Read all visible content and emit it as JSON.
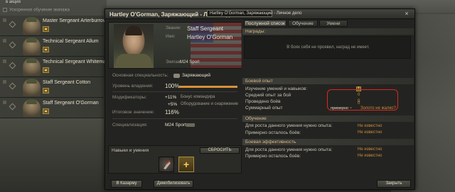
{
  "background": {
    "top_left_label": "в акция",
    "accelerated_training_label": "Ускоренное обучение экипажа"
  },
  "crew": [
    {
      "name": "Master Sergeant Arterburrow"
    },
    {
      "name": "Technical Sergeant Allum"
    },
    {
      "name": "Technical Sergeant Whiteman"
    },
    {
      "name": "Staff Sergeant Cotton"
    },
    {
      "name": "Staff Sergeant O'Gorman"
    }
  ],
  "dialog": {
    "title": "Hartley O'Gorman, Заряжающий - Личное дело",
    "close_glyph": "×",
    "profile": {
      "rank_label": "Звание:",
      "rank_value": "Staff Sergeant",
      "name_label": "Имя:",
      "name_value": "Hartley O'Gorman",
      "vehicle_label": "Экипаж:",
      "vehicle_value": "M24 Sport"
    },
    "spec": {
      "main_spec_label": "Основная специальность:",
      "main_spec_value": "Заряжающий",
      "mastery_label": "Уровень владения:",
      "mastery_value": "100%",
      "mastery_fill": 1.0,
      "modifiers_label": "Модификаторы:",
      "mod1_value": "+11%",
      "mod1_note": "Бонус командира",
      "mod2_value": "+5%",
      "mod2_note": "Оборудование и снаряжение",
      "total_label": "Итоговое значение:",
      "total_value": "116%",
      "specialization_label": "Специализация:",
      "specialization_value": "M24 Sport"
    },
    "skills": {
      "header": "Навыки и умения",
      "reset_label": "СБРОСИТЬ",
      "add_glyph": "+"
    },
    "tabs": [
      {
        "label": "Послужной список"
      },
      {
        "label": "Обучение"
      },
      {
        "label": "Умени"
      }
    ],
    "tooltip": "Hartley O'Gorman, Заряжающий - Личное дело",
    "awards": {
      "header": "Награды:",
      "empty_message": "В боях себя не проявил, наград не имеет."
    },
    "combat_exp": {
      "header": "Боевой опыт",
      "rows": [
        {
          "label": "Изучение умений и навыков:",
          "value": "+"
        },
        {
          "label": "Средний опыт за бой",
          "value": "0"
        },
        {
          "label": "Проведено боёв",
          "value": "0"
        },
        {
          "label": "Суммарный опыт",
          "value": "0"
        }
      ],
      "annotation_prefix": "примерно ~",
      "annotation_text": "Золото не жалко?"
    },
    "training": {
      "header": "Обучение",
      "rows": [
        {
          "label": "Для роста данного умения нужно опыта:",
          "value": "Не известно"
        },
        {
          "label": "Примерно осталось боёв:",
          "value": "Не известно"
        }
      ]
    },
    "efficiency": {
      "header": "Боевая эффективность",
      "rows": [
        {
          "label": "Для роста данного умения нужно опыта:",
          "value": "Не известно"
        },
        {
          "label": "Примерно осталось боёв:",
          "value": "Не известно"
        }
      ]
    },
    "buttons": {
      "to_barracks": "В Казарму",
      "demobilize": "Демобилизовать",
      "close": "Закрыть"
    }
  },
  "colors": {
    "accent_orange": "#cf8a3b",
    "highlight_red": "#e0241e",
    "section_header": "#d6b88a"
  }
}
